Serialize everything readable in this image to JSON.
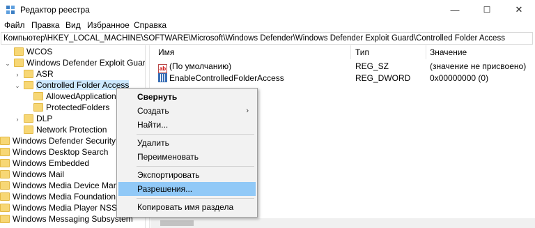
{
  "window": {
    "title": "Редактор реестра",
    "controls": {
      "minimize": "—",
      "maximize": "☐",
      "close": "✕"
    }
  },
  "menu": [
    "Файл",
    "Правка",
    "Вид",
    "Избранное",
    "Справка"
  ],
  "address": "Компьютер\\HKEY_LOCAL_MACHINE\\SOFTWARE\\Microsoft\\Windows Defender\\Windows Defender Exploit Guard\\Controlled Folder Access",
  "tree": [
    {
      "label": "WCOS",
      "expander": ""
    },
    {
      "label": "Windows Defender Exploit Guard",
      "expander": "⌄"
    },
    {
      "label": "ASR",
      "expander": "›"
    },
    {
      "label": "Controlled Folder Access",
      "expander": "⌄",
      "selected": true
    },
    {
      "label": "AllowedApplications",
      "expander": ""
    },
    {
      "label": "ProtectedFolders",
      "expander": ""
    },
    {
      "label": "DLP",
      "expander": "›"
    },
    {
      "label": "Network Protection",
      "expander": ""
    },
    {
      "label": "Windows Defender Security Center",
      "expander": ""
    },
    {
      "label": "Windows Desktop Search",
      "expander": ""
    },
    {
      "label": "Windows Embedded",
      "expander": ""
    },
    {
      "label": "Windows Mail",
      "expander": ""
    },
    {
      "label": "Windows Media Device Manager",
      "expander": ""
    },
    {
      "label": "Windows Media Foundation",
      "expander": ""
    },
    {
      "label": "Windows Media Player NSS",
      "expander": ""
    },
    {
      "label": "Windows Messaging Subsystem",
      "expander": ""
    }
  ],
  "list": {
    "columns": {
      "name": "Имя",
      "type": "Тип",
      "value": "Значение"
    },
    "rows": [
      {
        "icon": "string-value-icon",
        "name": "(По умолчанию)",
        "type": "REG_SZ",
        "value": "(значение не присвоено)"
      },
      {
        "icon": "dword-value-icon",
        "name": "EnableControlledFolderAccess",
        "type": "REG_DWORD",
        "value": "0x00000000 (0)"
      }
    ]
  },
  "context_menu": {
    "collapse": "Свернуть",
    "create": "Создать",
    "find": "Найти...",
    "delete": "Удалить",
    "rename": "Переименовать",
    "export": "Экспортировать",
    "permissions": "Разрешения...",
    "copy_key_name": "Копировать имя раздела",
    "submenu_arrow": "›"
  }
}
